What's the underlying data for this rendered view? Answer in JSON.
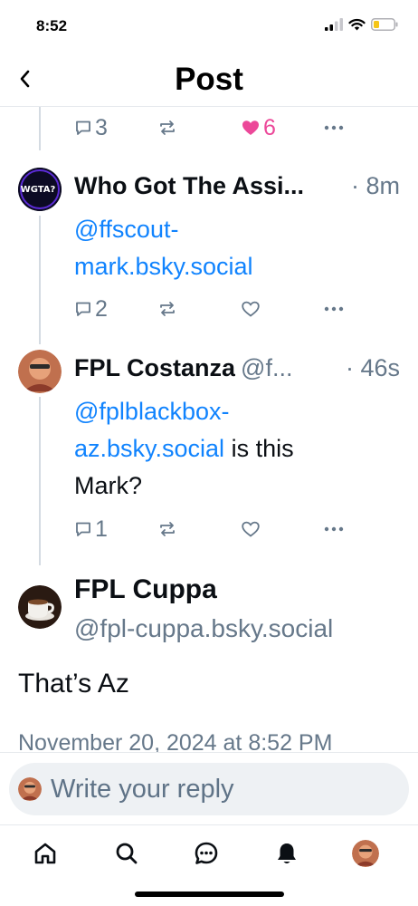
{
  "status_bar": {
    "time": "8:52"
  },
  "header": {
    "title": "Post"
  },
  "parent_post_actions": {
    "reply_count": "3",
    "like_count": "6"
  },
  "posts": [
    {
      "display_name": "Who Got The Assi...",
      "handle": "",
      "time": "· 8m",
      "avatar_text": "WGTA?",
      "text_mention": "@ffscout-mark.bsky.social",
      "text_rest": "",
      "reply_count": "2",
      "repost_count": "",
      "like_count": ""
    },
    {
      "display_name": "FPL Costanza",
      "handle": "@f...",
      "time": "· 46s",
      "text_mention": "@fplblackbox-az.bsky.social",
      "text_rest": " is this Mark?",
      "reply_count": "1",
      "repost_count": "",
      "like_count": ""
    }
  ],
  "main_post": {
    "display_name": "FPL Cuppa",
    "handle": "@fpl-cuppa.bsky.social",
    "text": "That’s Az",
    "timestamp": "November 20, 2024 at 8:52 PM"
  },
  "reply_bar": {
    "placeholder": "Write your reply"
  },
  "colors": {
    "accent": "#1083fe",
    "like": "#ec4899",
    "muted": "#66788a"
  }
}
